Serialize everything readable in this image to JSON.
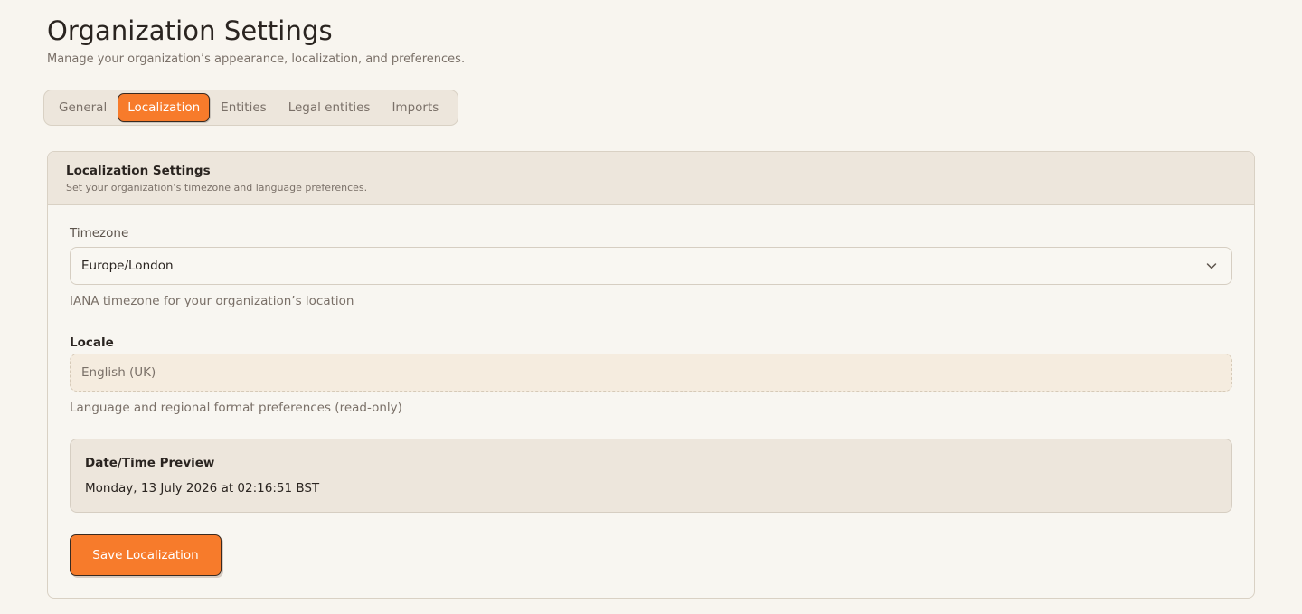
{
  "page": {
    "title": "Organization Settings",
    "subtitle": "Manage your organization’s appearance, localization, and preferences."
  },
  "tabs": [
    {
      "label": "General",
      "active": false
    },
    {
      "label": "Localization",
      "active": true
    },
    {
      "label": "Entities",
      "active": false
    },
    {
      "label": "Legal entities",
      "active": false
    },
    {
      "label": "Imports",
      "active": false
    }
  ],
  "card": {
    "title": "Localization Settings",
    "description": "Set your organization’s timezone and language preferences."
  },
  "timezone": {
    "label": "Timezone",
    "value": "Europe/London",
    "hint": "IANA timezone for your organization’s location",
    "icon": "chevron-down-icon"
  },
  "locale": {
    "label": "Locale",
    "value": "English (UK)",
    "hint": "Language and regional format preferences (read-only)"
  },
  "preview": {
    "title": "Date/Time Preview",
    "value": "Monday, 13 July 2026 at 02:16:51 BST"
  },
  "actions": {
    "save_label": "Save Localization"
  },
  "colors": {
    "accent": "#f77b2b",
    "background": "#f8f5ef",
    "panel": "#ede6dc"
  }
}
